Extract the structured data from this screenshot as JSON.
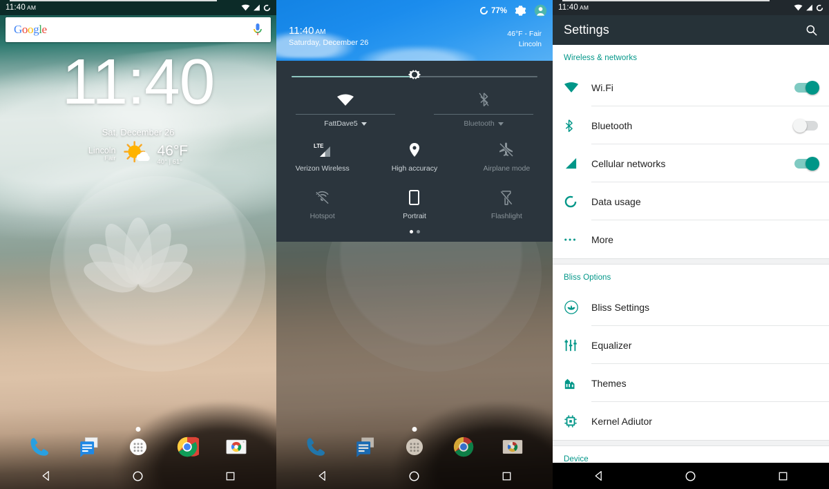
{
  "colors": {
    "teal": "#009688",
    "appbar": "#263238",
    "qs_dark": "#2b353d",
    "qs_blue": "#1b8ced"
  },
  "home": {
    "statusbar": {
      "clock": "11:40",
      "ampm": "AM",
      "icons": [
        "wifi-icon",
        "signal-icon",
        "circle-icon"
      ]
    },
    "search": {
      "logo": "Google",
      "logo_letters": [
        "G",
        "o",
        "o",
        "g",
        "l",
        "e"
      ],
      "mic": "microphone-icon"
    },
    "clock_widget": {
      "time": "11:40"
    },
    "weather_widget": {
      "date": "Sat, December 26",
      "city": "Lincoln",
      "condition": "Fair",
      "temp": "46°F",
      "hilo": "40° | 61°",
      "icon": "sun-cloud-icon"
    },
    "dock": [
      {
        "name": "phone",
        "icon": "phone-icon"
      },
      {
        "name": "messages",
        "icon": "messages-icon"
      },
      {
        "name": "all-apps",
        "icon": "apps-grid-icon"
      },
      {
        "name": "chrome",
        "icon": "chrome-icon"
      },
      {
        "name": "camera",
        "icon": "camera-icon"
      }
    ],
    "navbar": [
      {
        "name": "back",
        "icon": "back-triangle-icon"
      },
      {
        "name": "home",
        "icon": "home-circle-icon"
      },
      {
        "name": "recents",
        "icon": "recents-square-icon"
      }
    ]
  },
  "quicksettings": {
    "battery": {
      "percent": "77%",
      "icon": "battery-circle-icon"
    },
    "gear": "gear-icon",
    "user": "user-avatar-icon",
    "clock": "11:40",
    "ampm": "AM",
    "date": "Saturday, December 26",
    "weather_line1": "46°F - Fair",
    "weather_line2": "Lincoln",
    "brightness": {
      "icon": "brightness-icon",
      "value": 50
    },
    "dual_tiles": [
      {
        "label": "FattDave5",
        "icon": "wifi-icon",
        "state": "on"
      },
      {
        "label": "Bluetooth",
        "icon": "bluetooth-off-icon",
        "state": "off"
      }
    ],
    "tiles": [
      {
        "label": "Verizon Wireless",
        "icon": "lte-signal-icon",
        "state": "on"
      },
      {
        "label": "High accuracy",
        "icon": "location-pin-icon",
        "state": "on"
      },
      {
        "label": "Airplane mode",
        "icon": "airplane-off-icon",
        "state": "off"
      },
      {
        "label": "Hotspot",
        "icon": "hotspot-off-icon",
        "state": "off"
      },
      {
        "label": "Portrait",
        "icon": "rotation-portrait-icon",
        "state": "on"
      },
      {
        "label": "Flashlight",
        "icon": "flashlight-off-icon",
        "state": "off"
      }
    ],
    "pages": {
      "count": 2,
      "active": 0
    }
  },
  "settings": {
    "statusbar": {
      "clock": "11:40",
      "ampm": "AM"
    },
    "title": "Settings",
    "search_icon": "search-icon",
    "sections": [
      {
        "header": "Wireless & networks",
        "items": [
          {
            "label": "Wi.Fi",
            "icon": "wifi-icon",
            "toggle": "on"
          },
          {
            "label": "Bluetooth",
            "icon": "bluetooth-icon",
            "toggle": "off"
          },
          {
            "label": "Cellular networks",
            "icon": "signal-icon",
            "toggle": "on"
          },
          {
            "label": "Data usage",
            "icon": "data-usage-icon",
            "toggle": null
          },
          {
            "label": "More",
            "icon": "more-dots-icon",
            "toggle": null
          }
        ]
      },
      {
        "header": "Bliss Options",
        "items": [
          {
            "label": "Bliss Settings",
            "icon": "bliss-lotus-icon",
            "toggle": null
          },
          {
            "label": "Equalizer",
            "icon": "equalizer-icon",
            "toggle": null
          },
          {
            "label": "Themes",
            "icon": "themes-icon",
            "toggle": null
          },
          {
            "label": "Kernel Adiutor",
            "icon": "cpu-chip-icon",
            "toggle": null
          }
        ]
      },
      {
        "header": "Device",
        "items": []
      }
    ],
    "navbar": [
      {
        "name": "back",
        "icon": "back-triangle-icon"
      },
      {
        "name": "home",
        "icon": "home-circle-icon"
      },
      {
        "name": "recents",
        "icon": "recents-square-icon"
      }
    ]
  }
}
